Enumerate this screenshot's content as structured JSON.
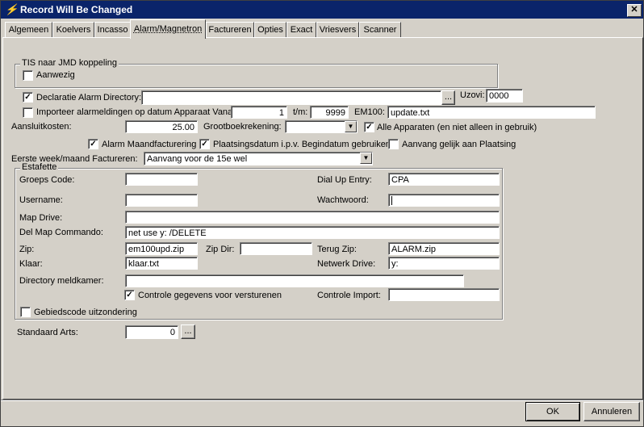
{
  "window": {
    "title": "Record Will Be Changed",
    "close_glyph": "✕",
    "icon": "app-icon"
  },
  "tabs": [
    {
      "label": "Algemeen"
    },
    {
      "label": "Koelvers"
    },
    {
      "label": "Incasso"
    },
    {
      "label": "Alarm/Magnetron"
    },
    {
      "label": "Factureren"
    },
    {
      "label": "Opties"
    },
    {
      "label": "Exact"
    },
    {
      "label": "Vriesvers"
    },
    {
      "label": "Scanner"
    }
  ],
  "active_tab": "Alarm/Magnetron",
  "tis": {
    "group_title": "TIS naar JMD koppeling",
    "aanwezig_label": "Aanwezig",
    "aanwezig_checked": false
  },
  "declaratie": {
    "label": "Declaratie Alarm",
    "checked": true,
    "directory_label": "Directory:",
    "directory_value": "",
    "browse": "...",
    "uzovi_label": "Uzovi:",
    "uzovi_value": "0000"
  },
  "importeer": {
    "label": "Importeer alarmeldingen op datum Apparaat Vanaf:",
    "checked": false,
    "vanaf": "1",
    "tm_label": "t/m:",
    "tm_value": "9999",
    "em100_label": "EM100:",
    "em100_value": "update.txt"
  },
  "aansluit": {
    "label": "Aansluitkosten:",
    "value": "25.00",
    "grootboek_label": "Grootboekrekening:",
    "grootboek_value": "",
    "alle_label": "Alle Apparaten (en niet alleen in gebruik)",
    "alle_checked": true
  },
  "flags": {
    "alarm_maand_label": "Alarm Maandfacturering",
    "alarm_maand_checked": true,
    "plaatsing_label": "Plaatsingsdatum i.p.v. Begindatum gebruiken",
    "plaatsing_checked": true,
    "aanvang_label": "Aanvang gelijk aan Plaatsing",
    "aanvang_checked": false
  },
  "eerste": {
    "label": "Eerste week/maand Factureren:",
    "value": "Aanvang voor de 15e wel"
  },
  "estafette": {
    "group_title": "Estafette",
    "groeps_label": "Groeps Code:",
    "groeps_value": "",
    "dialup_label": "Dial Up Entry:",
    "dialup_value": "CPA",
    "username_label": "Username:",
    "username_value": "",
    "wachtwoord_label": "Wachtwoord:",
    "wachtwoord_value": "",
    "map_label": "Map Drive:",
    "map_value": "",
    "delmap_label": "Del Map Commando:",
    "delmap_value": "net use y: /DELETE",
    "zip_label": "Zip:",
    "zip_value": "em100upd.zip",
    "zipdir_label": "Zip Dir:",
    "zipdir_value": "",
    "terugzip_label": "Terug Zip:",
    "terugzip_value": "ALARM.zip",
    "klaar_label": "Klaar:",
    "klaar_value": "klaar.txt",
    "netwerk_label": "Netwerk Drive:",
    "netwerk_value": "y:",
    "dirmeld_label": "Directory meldkamer:",
    "dirmeld_value": "",
    "controle_label": "Controle gegevens voor versturenen",
    "controle_checked": true,
    "controle_import_label": "Controle Import:",
    "controle_import_value": "",
    "gebied_label": "Gebiedscode uitzondering",
    "gebied_checked": false
  },
  "standaard": {
    "label": "Standaard Arts:",
    "value": "0",
    "browse": "..."
  },
  "footer": {
    "ok": "OK",
    "annuleren": "Annuleren"
  }
}
